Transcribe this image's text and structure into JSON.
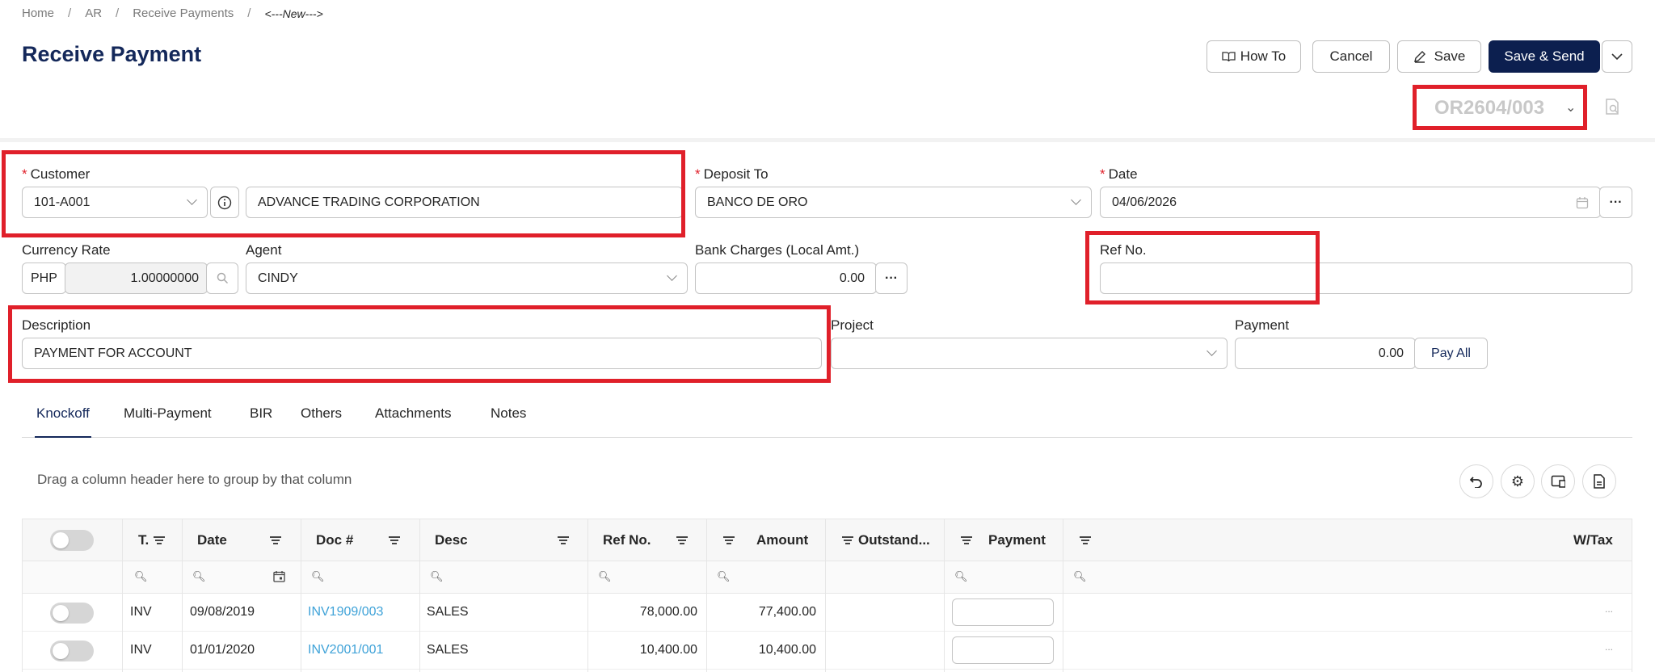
{
  "breadcrumb": [
    "Home",
    "AR",
    "Receive Payments",
    "<---New--->"
  ],
  "page_title": "Receive Payment",
  "toolbar": {
    "howto": "How To",
    "cancel": "Cancel",
    "save": "Save",
    "save_send": "Save & Send"
  },
  "doc_number": "OR2604/003",
  "form": {
    "customer_label": "Customer",
    "customer_code": "101-A001",
    "customer_name": "ADVANCE TRADING CORPORATION",
    "deposit_label": "Deposit To",
    "deposit_value": "BANCO DE ORO",
    "date_label": "Date",
    "date_value": "04/06/2026",
    "currency_label": "Currency Rate",
    "currency_code": "PHP",
    "currency_rate": "1.00000000",
    "agent_label": "Agent",
    "agent_value": "CINDY",
    "bank_label": "Bank Charges (Local Amt.)",
    "bank_value": "0.00",
    "ref_label": "Ref No.",
    "ref_value": "",
    "desc_label": "Description",
    "desc_value": "PAYMENT FOR ACCOUNT",
    "project_label": "Project",
    "project_value": "",
    "payment_label": "Payment",
    "payment_value": "0.00",
    "pay_all": "Pay All"
  },
  "tabs": [
    "Knockoff",
    "Multi-Payment",
    "BIR",
    "Others",
    "Attachments",
    "Notes"
  ],
  "group_hint": "Drag a column header here to group by that column",
  "grid": {
    "columns": [
      "T.",
      "Date",
      "Doc #",
      "Desc",
      "Ref No.",
      "Amount",
      "Outstand...",
      "Payment",
      "W/Tax"
    ],
    "rows": [
      {
        "type": "INV",
        "date": "09/08/2019",
        "doc": "INV1909/003",
        "desc": "SALES",
        "ref": "",
        "amount": "78,000.00",
        "outstanding": "77,400.00",
        "wtax": "..."
      },
      {
        "type": "INV",
        "date": "01/01/2020",
        "doc": "INV2001/001",
        "desc": "SALES",
        "ref": "",
        "amount": "10,400.00",
        "outstanding": "10,400.00",
        "wtax": "..."
      }
    ]
  },
  "colors": {
    "accent": "#0c1f4f",
    "highlight": "#e0202a",
    "link": "#3ea2d8",
    "required": "#e0202a"
  }
}
